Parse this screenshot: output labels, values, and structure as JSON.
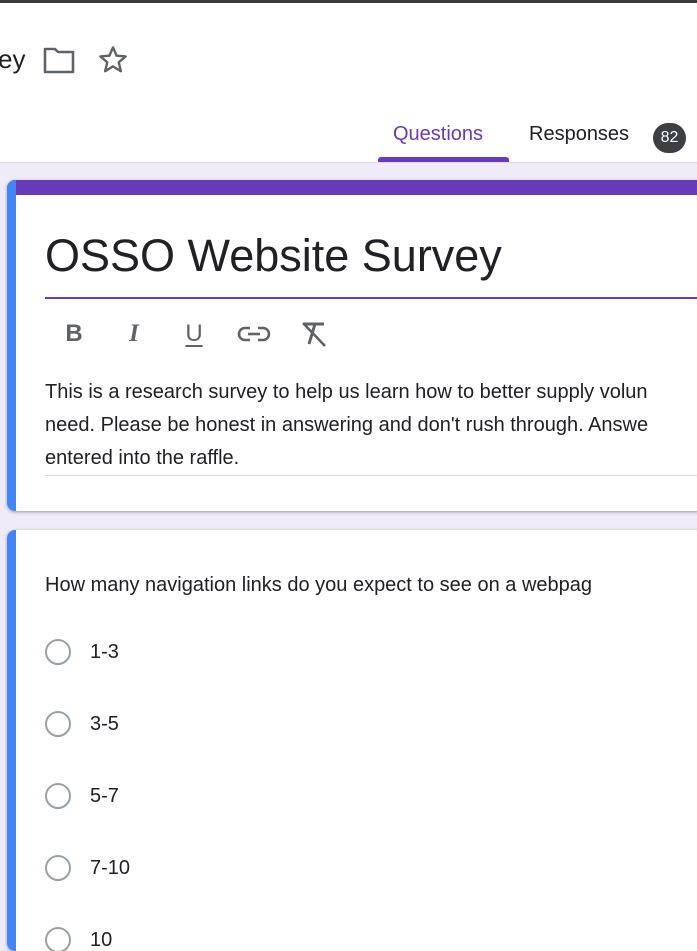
{
  "header": {
    "title_fragment": "ey",
    "folder_icon": "folder-icon",
    "star_icon": "star-outline-icon"
  },
  "tabs": [
    {
      "label": "Questions",
      "active": true
    },
    {
      "label": "Responses",
      "active": false,
      "count": "82"
    }
  ],
  "form": {
    "title": "OSSO Website Survey",
    "formatting": {
      "bold": "B",
      "italic": "I",
      "underline": "U",
      "link_icon": "link-icon",
      "clear_icon": "clear-formatting-icon"
    },
    "description_lines": [
      "This is a research survey to help us learn how to better supply volun",
      "need. Please be honest in answering and don't rush through. Answe",
      "entered into the raffle."
    ]
  },
  "question": {
    "text": "How many navigation links do you expect to see on a webpag",
    "options": [
      "1-3",
      "3-5",
      "5-7",
      "7-10",
      "10"
    ]
  },
  "colors": {
    "accent_purple": "#673ab7",
    "card_blue_bar": "#4285f4",
    "page_background": "#f0ebf8",
    "badge_background": "#3c4043"
  }
}
